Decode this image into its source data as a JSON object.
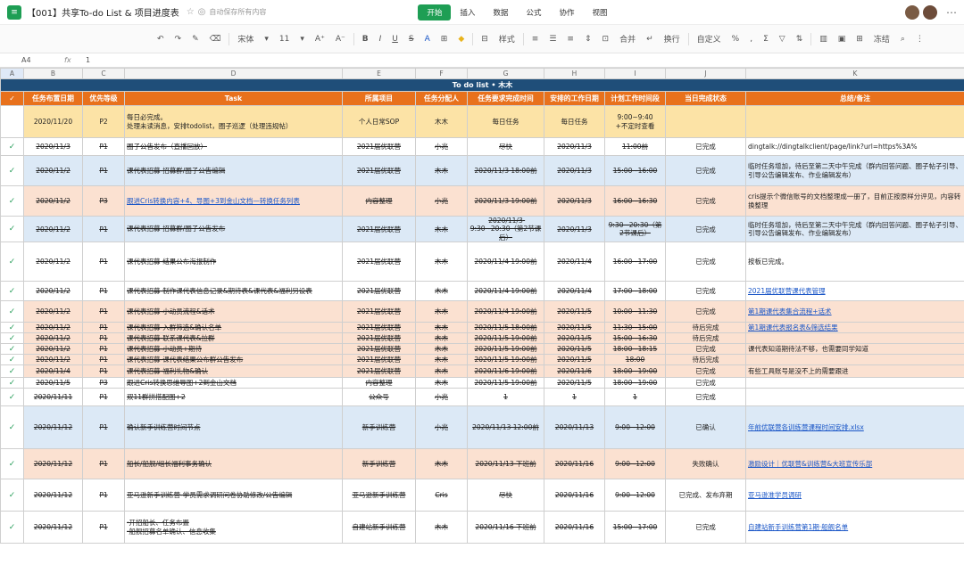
{
  "app": {
    "title": "【001】共享To-do List & 项目进度表",
    "save_status": "自动保存所有内容",
    "menu": [
      "开始",
      "插入",
      "数据",
      "公式",
      "协作",
      "视图"
    ]
  },
  "toolbar": {
    "font": "宋体",
    "size": "11",
    "style_btn": "样式",
    "merge_btn": "合并",
    "wrap_btn": "换行",
    "custom": "自定义",
    "freeze": "冻结"
  },
  "formula": {
    "cell": "A4",
    "fx": "fx",
    "value": "1"
  },
  "columns": [
    "A",
    "B",
    "C",
    "D",
    "E",
    "F",
    "G",
    "H",
    "I",
    "J",
    "K"
  ],
  "banner": "To do list • 木木",
  "headers": [
    "✓",
    "任务布置日期",
    "优先等级",
    "Task",
    "所属项目",
    "任务分配人",
    "任务要求完成时间",
    "安排的工作日期",
    "计划工作时间段",
    "当日完成状态",
    "总结/备注"
  ],
  "rows": [
    {
      "style": "r-yellow",
      "check": "",
      "date": "2020/11/20",
      "pri": "P2",
      "task": "每日必完成。\n处理未读消息，安排todolist，圈子巡逻（处理违规帖）",
      "proj": "个人日常SOP",
      "owner": "木木",
      "due": "每日任务",
      "work": "每日任务",
      "time": "9:00~9:40\n+不定时查看",
      "status": "",
      "note": "",
      "strike": false,
      "h": 36
    },
    {
      "style": "r-white",
      "check": "✓",
      "date": "2020/11/3",
      "pri": "P1",
      "task": "圈子公告发布（直播回放）",
      "proj": "2021届优联营",
      "owner": "小兆",
      "due": "尽快",
      "work": "2020/11/3",
      "time": "11:00前",
      "status": "已完成",
      "note": "dingtalk://dingtalkclient/page/link?url=https%3A%",
      "strike": true,
      "h": 20
    },
    {
      "style": "r-blue",
      "check": "✓",
      "date": "2020/11/2",
      "pri": "P1",
      "task": "课代表招募-招募群/圈子公告编辑",
      "proj": "2021届优联营",
      "owner": "木木",
      "due": "2020/11/3 18:00前",
      "work": "2020/11/3",
      "time": "15:00~16:00",
      "status": "已完成",
      "note": "临时任务增加，待后至第二天中午完成（群内回答问题、圈子帖子引导、引导公告编辑发布、作业编辑发布）",
      "strike": true,
      "h": 34
    },
    {
      "style": "r-peach",
      "check": "✓",
      "date": "2020/11/2",
      "pri": "P3",
      "task": "跟进Cris转换内容+4、导图+3到金山文档—转换任务列表",
      "proj": "内容整理",
      "owner": "小兆",
      "due": "2020/11/3 19:00前",
      "work": "2020/11/3",
      "time": "16:00~16:30",
      "status": "已完成",
      "note": "cris提示个微信账号的文档整理成一册了，目前正按原样分评见，内容转换整理",
      "strike": true,
      "link": true,
      "h": 34
    },
    {
      "style": "r-blue",
      "check": "✓",
      "date": "2020/11/2",
      "pri": "P1",
      "task": "课代表招募-招募群/圈子公告发布",
      "proj": "2021届优联营",
      "owner": "木木",
      "due": "2020/11/3 9:30~20:30（第2节课后）",
      "work": "2020/11/3",
      "time": "9:30~20:30（第2节课后）",
      "status": "已完成",
      "note": "临时任务增加，待后至第二天中午完成（群内回答问题、圈子帖子引导、引导公告编辑发布、作业编辑发布）",
      "strike": true,
      "h": 20
    },
    {
      "style": "r-white",
      "check": "✓",
      "date": "2020/11/2",
      "pri": "P1",
      "task": "课代表招募-结果公布海报制作",
      "proj": "2021届优联营",
      "owner": "木木",
      "due": "2020/11/4 19:00前",
      "work": "2020/11/4",
      "time": "16:00~17:00",
      "status": "已完成",
      "note": "按板已完成。",
      "strike": true,
      "h": 44
    },
    {
      "style": "r-white",
      "check": "✓",
      "date": "2020/11/2",
      "pri": "P1",
      "task": "课代表招募-制作课代表信息记录&期待表&课代表&福利另设表",
      "proj": "2021届优联营",
      "owner": "木木",
      "due": "2020/11/4 19:00前",
      "work": "2020/11/4",
      "time": "17:00~18:00",
      "status": "已完成",
      "note": "2021届优联营课代表管理",
      "strike": true,
      "notelink": true,
      "h": 22
    },
    {
      "style": "r-peach",
      "check": "✓",
      "date": "2020/11/2",
      "pri": "P1",
      "task": "课代表招募-小动员流程&话术",
      "proj": "2021届优联营",
      "owner": "木木",
      "due": "2020/11/4 19:00前",
      "work": "2020/11/5",
      "time": "10:00~11:30",
      "status": "已完成",
      "note": "第1期课代表集合流程+话术",
      "strike": true,
      "notelink": true,
      "h": 24
    },
    {
      "style": "r-peach",
      "check": "✓",
      "date": "2020/11/2",
      "pri": "P1",
      "task": "课代表招募-入群筛选&确认名单",
      "proj": "2021届优联营",
      "owner": "木木",
      "due": "2020/11/5 18:00前",
      "work": "2020/11/5",
      "time": "11:30~15:00",
      "status": "待后完成",
      "note": "第1期课代表报名表&筛选结果",
      "strike": true,
      "notelink": true,
      "h": 12
    },
    {
      "style": "r-peach",
      "check": "✓",
      "date": "2020/11/2",
      "pri": "P1",
      "task": "课代表招募-联系课代表&拉群",
      "proj": "2021届优联营",
      "owner": "木木",
      "due": "2020/11/5 19:00前",
      "work": "2020/11/5",
      "time": "15:00~16:30",
      "status": "待后完成",
      "note": "",
      "strike": true,
      "h": 12
    },
    {
      "style": "r-peach",
      "check": "✓",
      "date": "2020/11/2",
      "pri": "P1",
      "task": "课代表招募-小动员+期待",
      "proj": "2021届优联营",
      "owner": "木木",
      "due": "2020/11/5 19:00前",
      "work": "2020/11/5",
      "time": "18:00~18:15",
      "status": "已完成",
      "note": "课代表知道期待法不够，也需要同学知道",
      "strike": true,
      "h": 12
    },
    {
      "style": "r-peach",
      "check": "✓",
      "date": "2020/11/2",
      "pri": "P1",
      "task": "课代表招募-课代表结果公布群公告发布",
      "proj": "2021届优联营",
      "owner": "木木",
      "due": "2020/11/5 19:00前",
      "work": "2020/11/5",
      "time": "18:00",
      "status": "待后完成",
      "note": "",
      "strike": true,
      "h": 12
    },
    {
      "style": "r-peach",
      "check": "✓",
      "date": "2020/11/4",
      "pri": "P1",
      "task": "课代表招募-福利礼物&确认",
      "proj": "2021届优联营",
      "owner": "木木",
      "due": "2020/11/6 19:00前",
      "work": "2020/11/6",
      "time": "18:00~19:00",
      "status": "已完成",
      "note": "有些工具账号是没不上的需要跟进",
      "strike": true,
      "h": 14
    },
    {
      "style": "r-white",
      "check": "✓",
      "date": "2020/11/5",
      "pri": "P3",
      "task": "跟进Cris转换思维导图+2到金山文档",
      "proj": "内容整理",
      "owner": "木木",
      "due": "2020/11/5 19:00前",
      "work": "2020/11/5",
      "time": "18:00~19:00",
      "status": "已完成",
      "note": "",
      "strike": true,
      "h": 12
    },
    {
      "style": "r-white",
      "check": "✓",
      "date": "2020/11/11",
      "pri": "P1",
      "task": "双11群拼搭配图+2",
      "proj": "公众号",
      "owner": "小兆",
      "due": "1",
      "work": "1",
      "time": "1",
      "status": "已完成",
      "note": "",
      "strike": true,
      "h": 20
    },
    {
      "style": "r-blue",
      "check": "✓",
      "date": "2020/11/12",
      "pri": "P1",
      "task": "确认新手训练营时间节点",
      "proj": "新手训练营",
      "owner": "小兆",
      "due": "2020/11/13 12:00前",
      "work": "2020/11/13",
      "time": "9:00~12:00",
      "status": "已确认",
      "note": "年前优联营各训练营课程时间安排.xlsx",
      "strike": true,
      "notelink": true,
      "h": 48
    },
    {
      "style": "r-peach",
      "check": "✓",
      "date": "2020/11/12",
      "pri": "P1",
      "task": "船长/船舰/组长福利事务确认",
      "proj": "新手训练营",
      "owner": "木木",
      "due": "2020/11/13 下班前",
      "work": "2020/11/16",
      "time": "9:00~12:00",
      "status": "失败确认",
      "note": "激励设计｜优联营&训练营&大班宣传乐部",
      "strike": true,
      "notelink": true,
      "h": 34
    },
    {
      "style": "r-white",
      "check": "✓",
      "date": "2020/11/12",
      "pri": "P1",
      "task": "亚马逊新手训练营-学员需求调研问卷协助修改/公告编辑",
      "proj": "亚马逊新手训练营",
      "owner": "Cris",
      "due": "尽快",
      "work": "2020/11/16",
      "time": "9:00~12:00",
      "status": "已完成、发布弃期",
      "note": "亚马逊准学员调研",
      "strike": true,
      "notelink": true,
      "h": 36
    },
    {
      "style": "r-white",
      "check": "✓",
      "date": "2020/11/12",
      "pri": "P1",
      "task": "·开招船长、任务布置\n·船舰招募名单确认、信息收集",
      "proj": "自建站新手训练营",
      "owner": "木木",
      "due": "2020/11/16 下班前",
      "work": "2020/11/16",
      "time": "15:00~17:00",
      "status": "已完成",
      "note": "自建站新手训练营第1期·船舰名单",
      "strike": true,
      "notelink": true,
      "h": 36
    }
  ]
}
